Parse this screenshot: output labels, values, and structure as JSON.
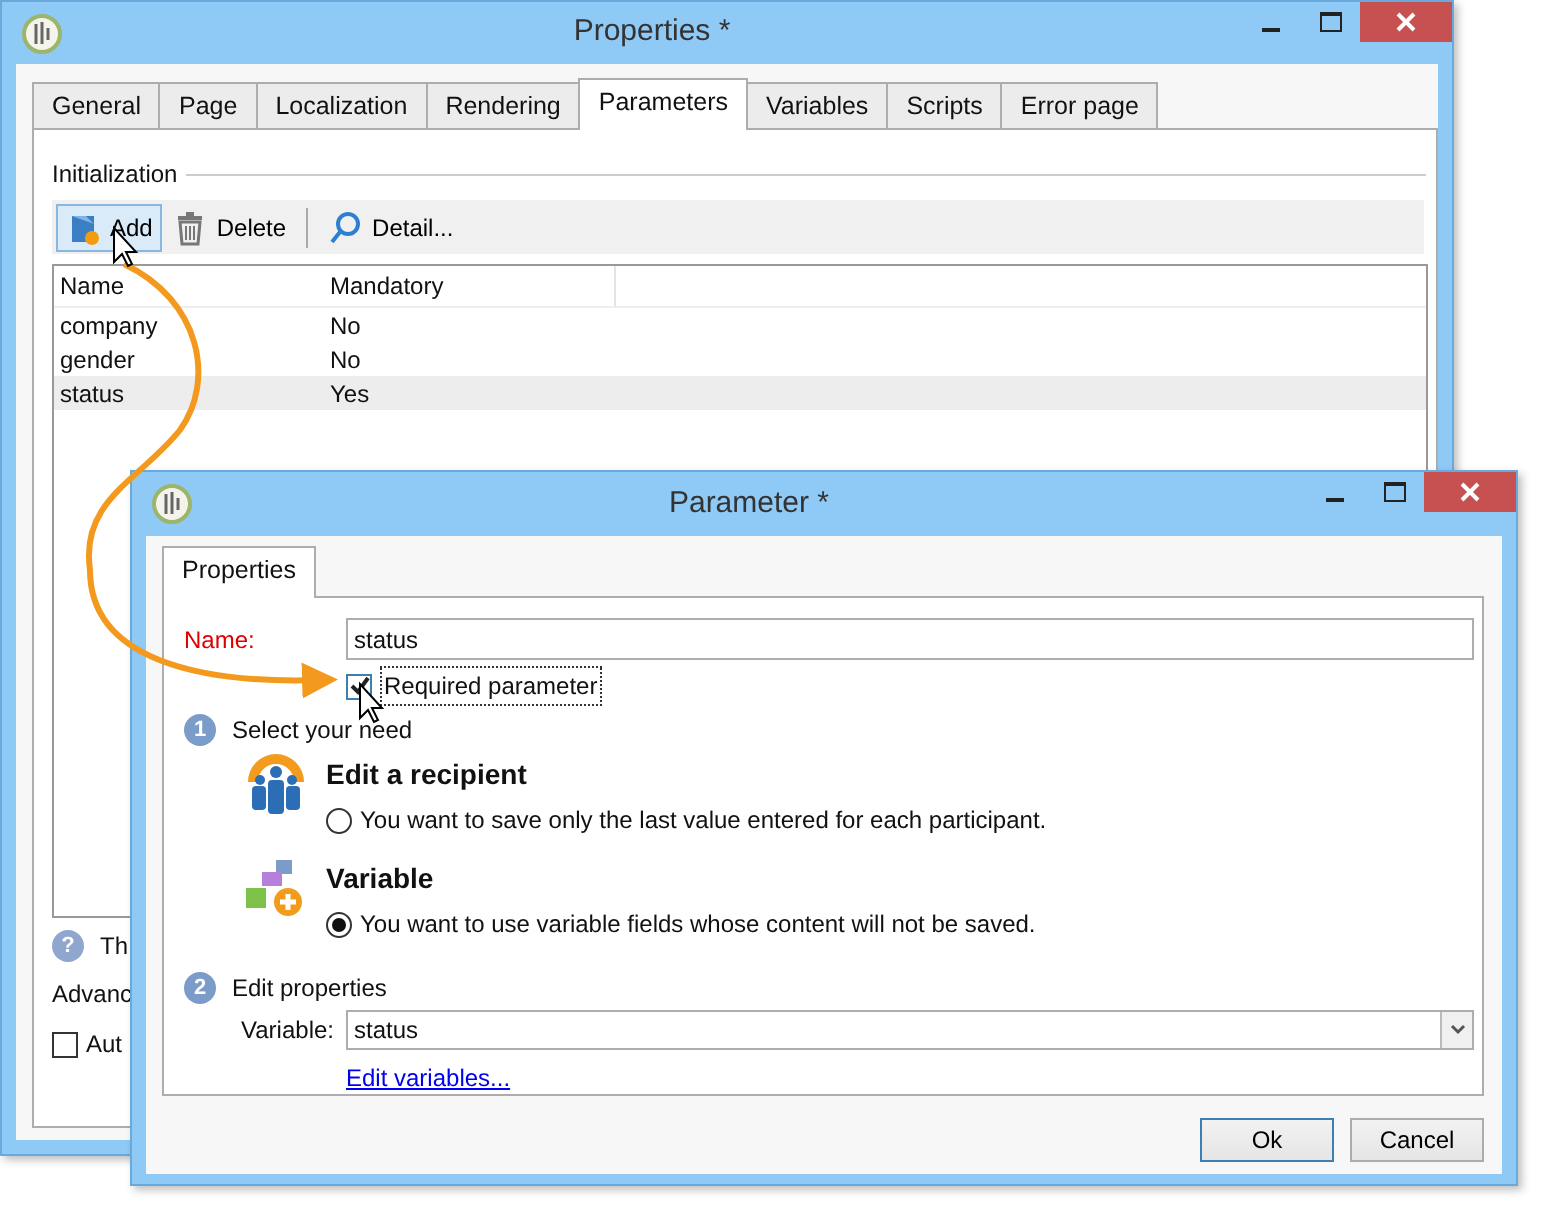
{
  "main_window": {
    "title": "Properties *",
    "tabs": [
      {
        "label": "General",
        "selected": false
      },
      {
        "label": "Page",
        "selected": false
      },
      {
        "label": "Localization",
        "selected": false
      },
      {
        "label": "Rendering",
        "selected": false
      },
      {
        "label": "Parameters",
        "selected": true
      },
      {
        "label": "Variables",
        "selected": false
      },
      {
        "label": "Scripts",
        "selected": false
      },
      {
        "label": "Error page",
        "selected": false
      }
    ],
    "section_title": "Initialization",
    "toolbar": [
      {
        "kind": "add",
        "label": "Add",
        "hovered": true
      },
      {
        "kind": "delete",
        "label": "Delete",
        "hovered": false
      },
      {
        "kind": "detail",
        "label": "Detail...",
        "hovered": false
      }
    ],
    "table": {
      "columns": [
        "Name",
        "Mandatory"
      ],
      "rows": [
        {
          "cells": [
            "company",
            "No"
          ],
          "selected": false
        },
        {
          "cells": [
            "gender",
            "No"
          ],
          "selected": false
        },
        {
          "cells": [
            "status",
            "Yes"
          ],
          "selected": true
        }
      ]
    },
    "help": {
      "icon": "?",
      "text": "Th"
    },
    "advanced_label": "Advanc",
    "checkbox": {
      "label": "Aut",
      "checked": false
    }
  },
  "dialog": {
    "title": "Parameter *",
    "tabs": [
      {
        "label": "Properties",
        "selected": true
      }
    ],
    "name_label": "Name:",
    "name_value": "status",
    "required": {
      "label": "Required parameter",
      "checked": true
    },
    "step1": {
      "number": "1",
      "label": "Select your need"
    },
    "options": [
      {
        "kind": "recipient",
        "title": "Edit a recipient",
        "text": "You want to save only the last value entered for each participant.",
        "selected": false
      },
      {
        "kind": "variable",
        "title": "Variable",
        "text": "You want to use variable fields whose content will not be saved.",
        "selected": true
      }
    ],
    "step2": {
      "number": "2",
      "label": "Edit properties"
    },
    "variable_label": "Variable:",
    "variable_value": "status",
    "link": "Edit variables...",
    "buttons": [
      {
        "label": "Ok",
        "default": true
      },
      {
        "label": "Cancel",
        "default": false
      }
    ]
  }
}
